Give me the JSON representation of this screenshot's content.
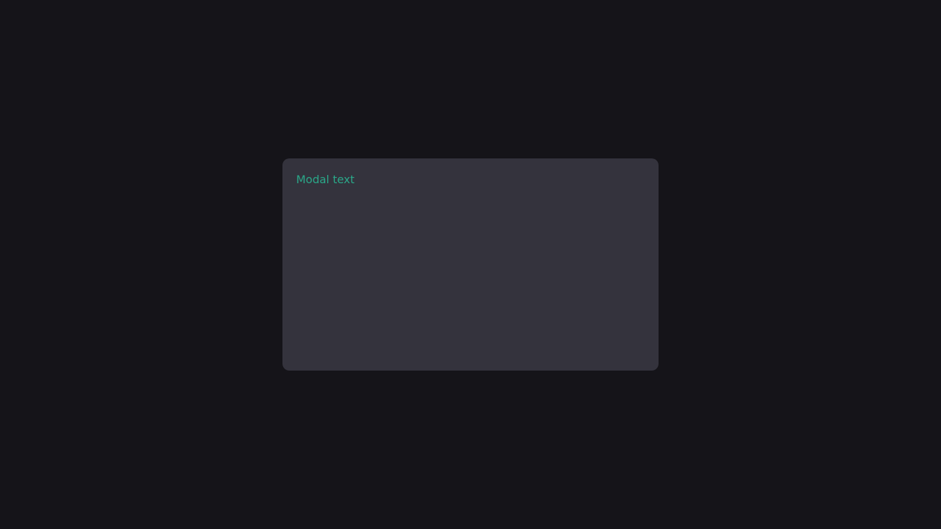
{
  "modal": {
    "text": "Modal text"
  },
  "colors": {
    "background": "#151419",
    "modal_surface": "#34333d",
    "accent_text": "#2aa889"
  }
}
